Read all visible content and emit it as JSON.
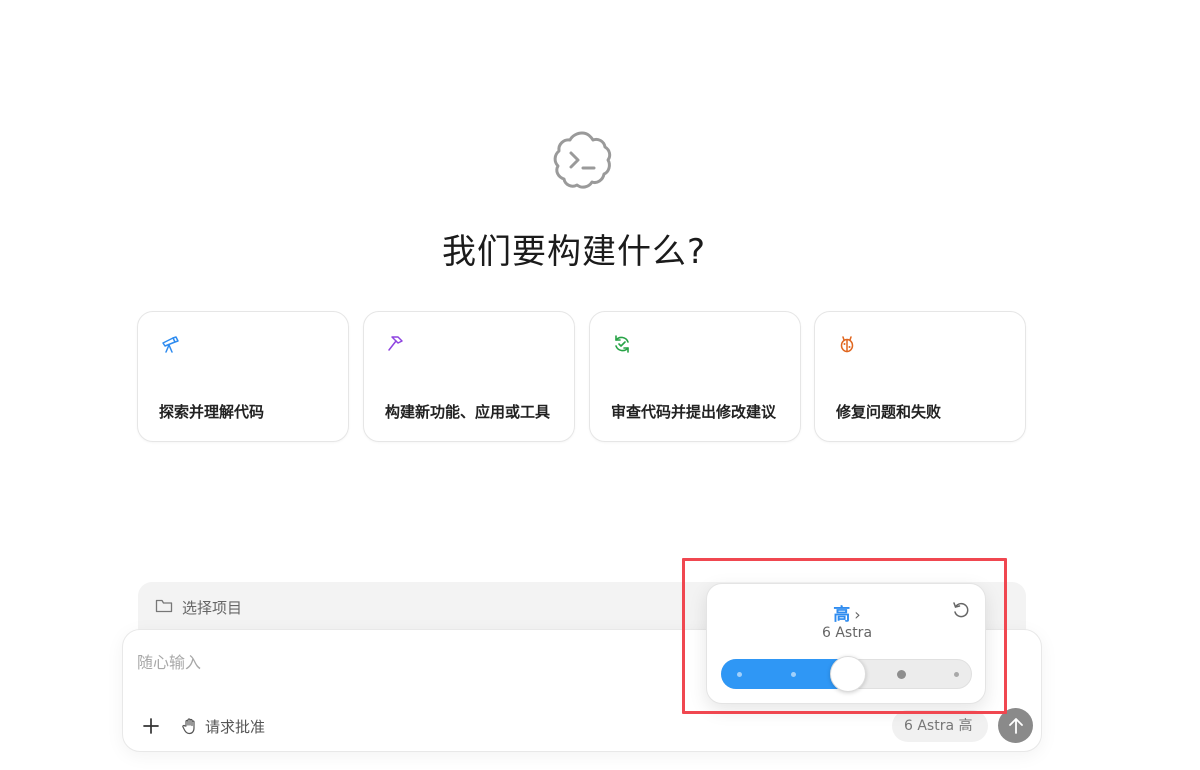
{
  "headline": "我们要构建什么?",
  "cards": [
    {
      "label": "探索并理解代码",
      "icon": "telescope-icon",
      "color": "#2f8cf0"
    },
    {
      "label": "构建新功能、应用或工具",
      "icon": "hammer-icon",
      "color": "#8e44e0"
    },
    {
      "label": "审查代码并提出修改建议",
      "icon": "review-refresh-icon",
      "color": "#27a346"
    },
    {
      "label": "修复问题和失败",
      "icon": "bug-icon",
      "color": "#e0661f"
    }
  ],
  "project_bar": {
    "label": "选择项目"
  },
  "composer": {
    "placeholder": "随心输入",
    "approve_label": "请求批准",
    "model_pill": "6 Astra  高"
  },
  "popover": {
    "level": "高",
    "model": "6 Astra",
    "slider": {
      "steps": 5,
      "selected_index": 2
    }
  },
  "colors": {
    "accent": "#2f97f5",
    "highlight": "#f04750"
  }
}
